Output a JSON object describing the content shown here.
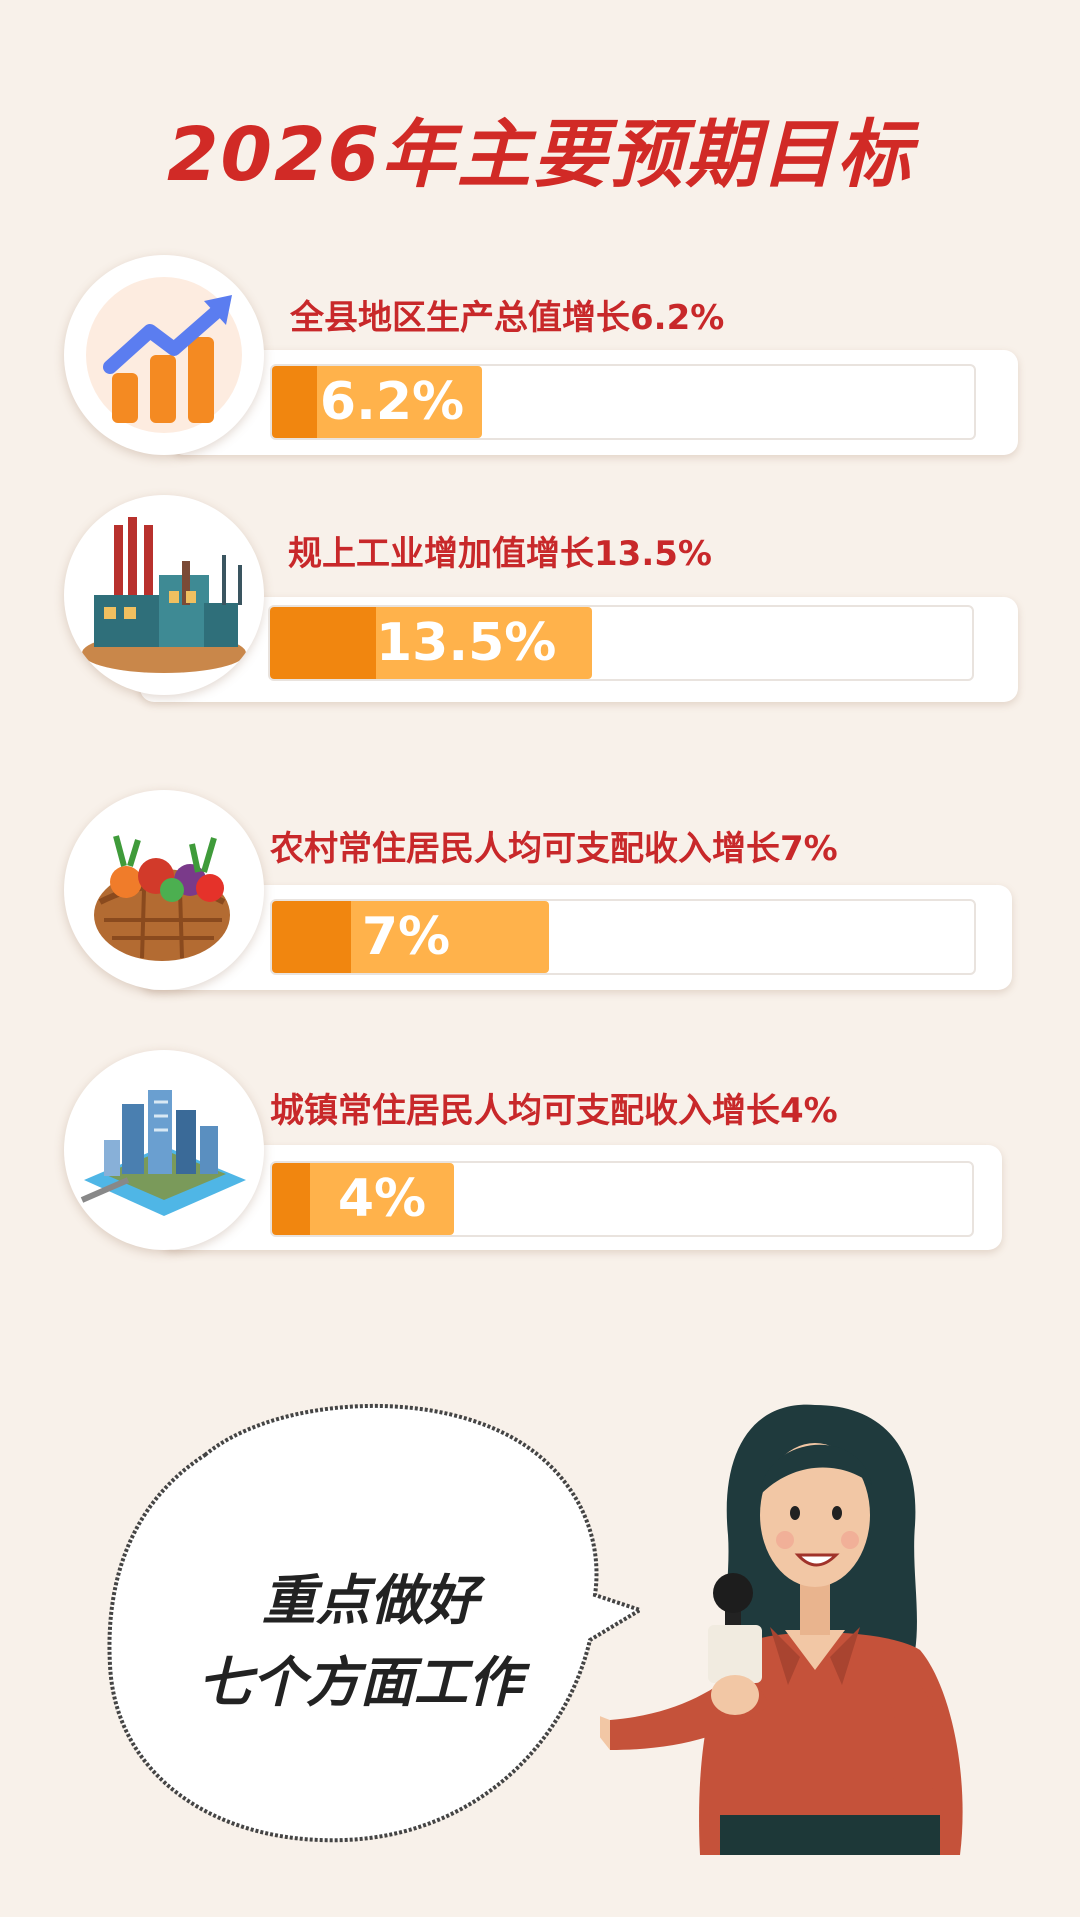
{
  "title": "2026年主要预期目标",
  "goals": [
    {
      "label": "全县地区生产总值增长6.2%",
      "value_text": "6.2%",
      "percent": 6.2,
      "icon": "growth-chart-icon"
    },
    {
      "label": "规上工业增加值增长13.5%",
      "value_text": "13.5%",
      "percent": 13.5,
      "icon": "factory-icon"
    },
    {
      "label": "农村常住居民人均可支配收入增长7%",
      "value_text": "7%",
      "percent": 7,
      "icon": "vegetable-basket-icon"
    },
    {
      "label": "城镇常住居民人均可支配收入增长4%",
      "value_text": "4%",
      "percent": 4,
      "icon": "city-icon"
    }
  ],
  "bubble": {
    "line1": "重点做好",
    "line2": "七个方面工作"
  },
  "colors": {
    "title": "#d12a26",
    "bar_dark": "#f1860f",
    "bar_light": "#ffb24b",
    "background": "#f8f1ea"
  }
}
